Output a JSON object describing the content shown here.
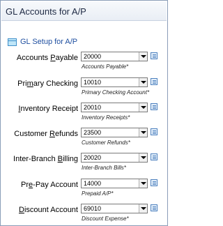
{
  "window": {
    "title": "GL Accounts for A/P"
  },
  "section": {
    "label": "GL Setup for A/P",
    "icon": "form-section-icon"
  },
  "fields": [
    {
      "label_pre": "Accounts ",
      "label_key": "P",
      "label_post": "ayable",
      "value": "20000",
      "description": "Accounts Payable*"
    },
    {
      "label_pre": "Pri",
      "label_key": "m",
      "label_post": "ary Checking",
      "value": "10010",
      "description": "Primary Checking Account*"
    },
    {
      "label_pre": "",
      "label_key": "I",
      "label_post": "nventory Receipt",
      "value": "20010",
      "description": "Inventory Receipts*"
    },
    {
      "label_pre": "Customer ",
      "label_key": "R",
      "label_post": "efunds",
      "value": "23500",
      "description": "Customer Refunds*"
    },
    {
      "label_pre": "Inter-Branch ",
      "label_key": "B",
      "label_post": "illing",
      "value": "20020",
      "description": "Inter-Branch Bills*"
    },
    {
      "label_pre": "Pr",
      "label_key": "e",
      "label_post": "-Pay Account",
      "value": "14000",
      "description": "Prepaid A/P*"
    },
    {
      "label_pre": "",
      "label_key": "D",
      "label_post": "iscount Account",
      "value": "69010",
      "description": "Discount Expense*"
    }
  ]
}
